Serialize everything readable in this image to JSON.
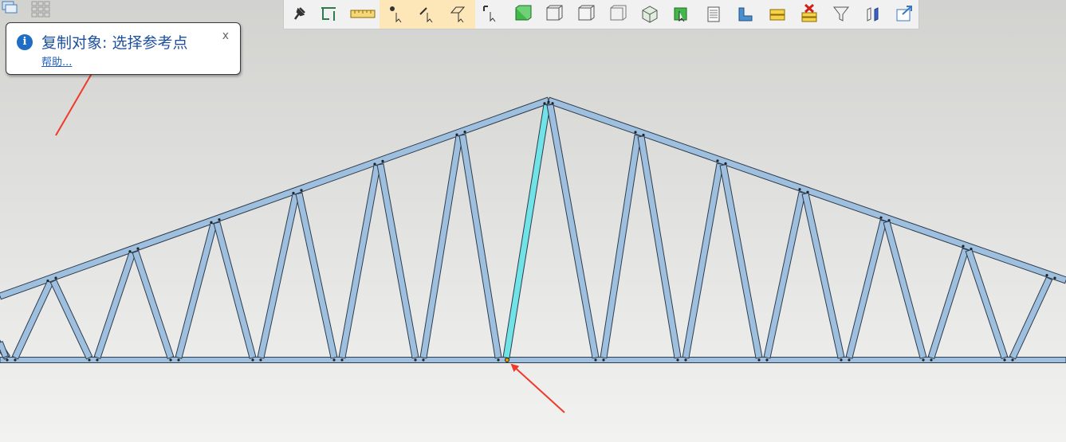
{
  "tooltip": {
    "title": "复制对象: 选择参考点",
    "help_link": "帮助...",
    "close_label": "x",
    "icon": "info-icon"
  },
  "toolbar": {
    "tools": [
      {
        "name": "pin-icon"
      },
      {
        "name": "select-tool-icon"
      },
      {
        "name": "measure-ruler-icon"
      },
      {
        "name": "snap-point-icon"
      },
      {
        "name": "snap-line-icon"
      },
      {
        "name": "snap-plane-icon"
      },
      {
        "name": "snap-reference-icon"
      },
      {
        "name": "view-solid-icon"
      },
      {
        "name": "view-wireframe-icon"
      },
      {
        "name": "view-hidden-line-icon"
      },
      {
        "name": "view-outline-icon"
      },
      {
        "name": "view-shaded-icon"
      },
      {
        "name": "select-objects-icon"
      },
      {
        "name": "document-icon"
      },
      {
        "name": "profile-icon"
      },
      {
        "name": "layers-icon"
      },
      {
        "name": "delete-layers-icon"
      },
      {
        "name": "filter-icon"
      },
      {
        "name": "parts-icon"
      },
      {
        "name": "export-icon"
      }
    ]
  },
  "colors": {
    "member_fill": "#9ec0de",
    "member_stroke": "#2d3c4e",
    "selected_member": "#6fe3e6",
    "annotation_arrow": "#ef3a2b",
    "toolbar_highlight": "#fde6b8"
  }
}
